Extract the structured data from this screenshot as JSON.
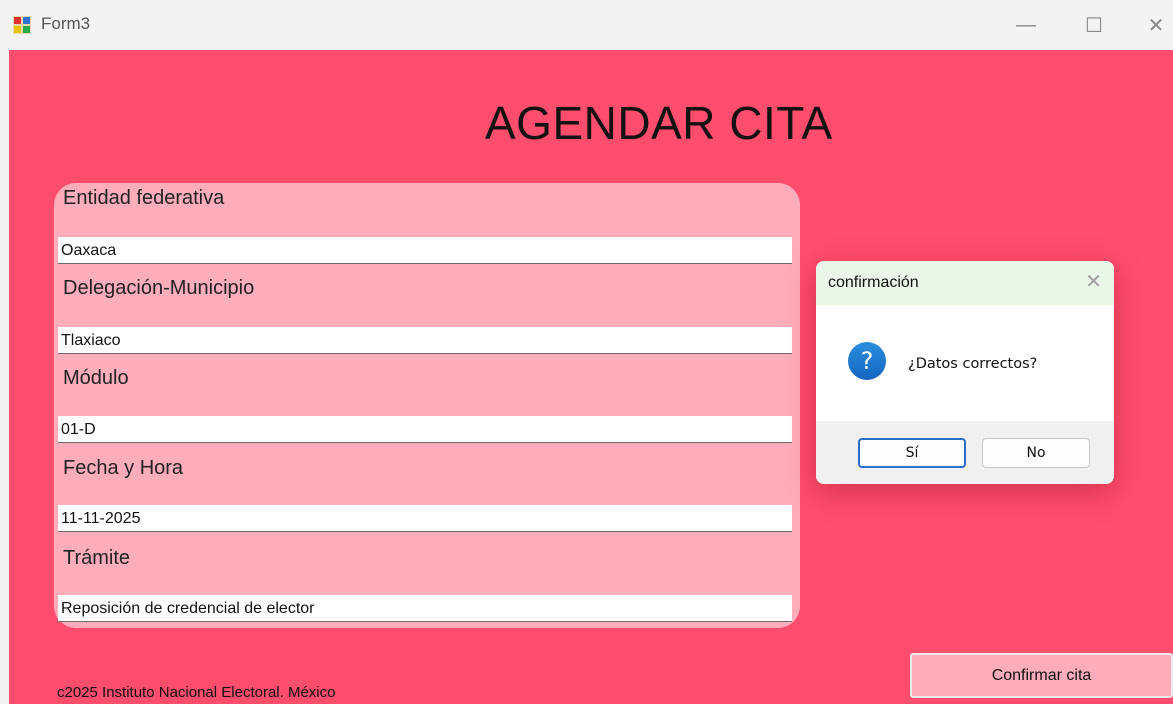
{
  "window": {
    "title": "Form3",
    "minimize_glyph": "—",
    "maximize_glyph": "☐",
    "close_glyph": "✕",
    "icon": "windows-form-icon"
  },
  "form": {
    "heading": "AGENDAR CITA",
    "background_color": "#ff4d6d",
    "panel_color": "#ffadba",
    "fields": [
      {
        "label": "Entidad federativa",
        "value": "Oaxaca"
      },
      {
        "label": "Delegación-Municipio",
        "value": "Tlaxiaco"
      },
      {
        "label": "Módulo",
        "value": "01-D"
      },
      {
        "label": "Fecha y Hora",
        "value": "11-11-2025"
      },
      {
        "label": "Trámite",
        "value": "Reposición de credencial de elector"
      }
    ],
    "footer": "c2025 Instituto Nacional Electoral. México",
    "confirm_button": "Confirmar cita"
  },
  "dialog": {
    "title": "confirmación",
    "close_glyph": "✕",
    "icon": "question-icon",
    "message": "¿Datos correctos?",
    "yes_button": "Sí",
    "no_button": "No",
    "accent_color": "#2a6fc4"
  }
}
